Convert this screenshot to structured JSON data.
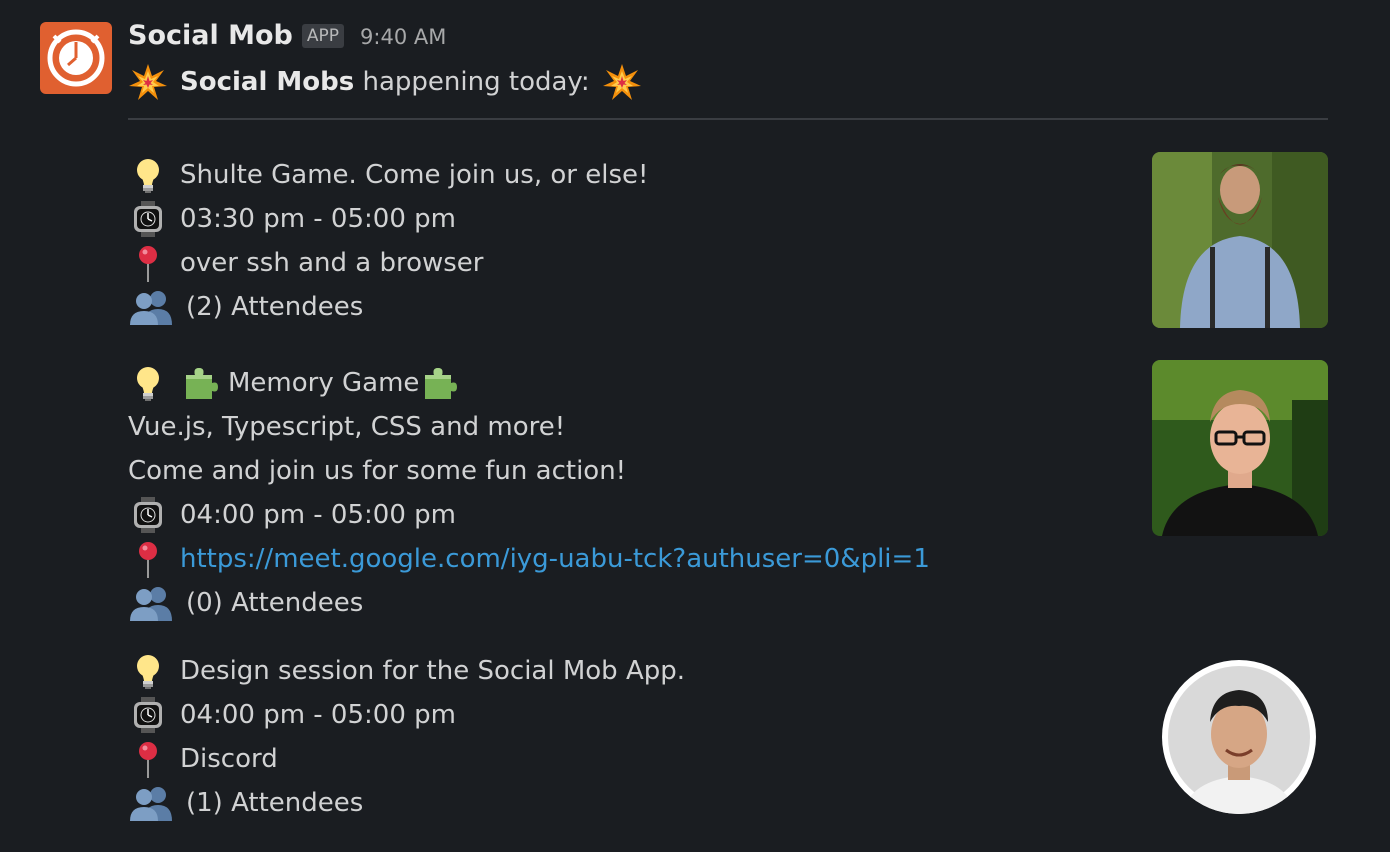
{
  "message": {
    "sender": "Social Mob",
    "badge": "APP",
    "time": "9:40 AM",
    "intro_bold": "Social Mobs",
    "intro_rest": " happening today:"
  },
  "events": [
    {
      "title": "Shulte Game. Come join us, or else!",
      "time": "03:30 pm - 05:00 pm",
      "location": "over ssh and a browser",
      "attendees": "(2) Attendees"
    },
    {
      "title": "Memory Game",
      "description_1": "Vue.js, Typescript, CSS and more!",
      "description_2": "Come and join us for some fun action!",
      "time": "04:00 pm - 05:00 pm",
      "location": "https://meet.google.com/iyg-uabu-tck?authuser=0&pli=1",
      "attendees": "(0) Attendees"
    },
    {
      "title": "Design session for the Social Mob App.",
      "time": "04:00 pm - 05:00 pm",
      "location": "Discord",
      "attendees": "(1) Attendees"
    }
  ],
  "icons": {
    "app_avatar": "clock-logo-icon",
    "sparkle": "collision-icon",
    "idea": "lightbulb-icon",
    "time": "watch-icon",
    "location": "round-pushpin-icon",
    "attendees": "busts-in-silhouette-icon",
    "puzzle": "puzzle-piece-icon"
  },
  "colors": {
    "background": "#1a1d21",
    "text": "#d1d2d3",
    "link": "#3b9ad8",
    "app_avatar": "#e06030"
  }
}
